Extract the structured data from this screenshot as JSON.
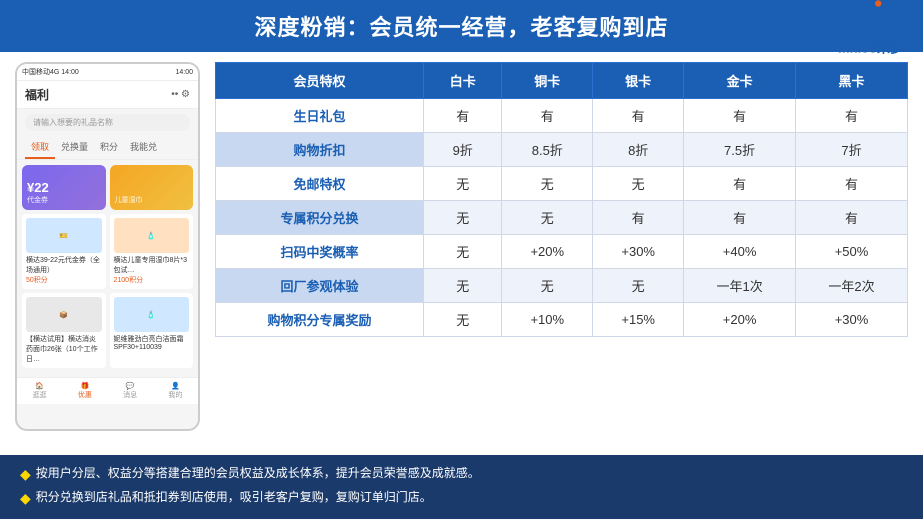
{
  "header": {
    "title": "深度粉销：会员统一经营，老客复购到店"
  },
  "logo": {
    "name": "midoo米多",
    "alt": "midoo logo"
  },
  "phone": {
    "status_bar": "中国移动4G  14:00",
    "nav_title": "福利",
    "search_placeholder": "请输入想要的礼品名称",
    "tabs": [
      "领取",
      "兑换量",
      "积分",
      "我能兑"
    ],
    "active_tab": "领取",
    "card1_amount": "¥22",
    "card1_desc": "代金券",
    "card2_desc": "儿童湿巾",
    "product1_name": "横达39-22元代金券（全场通用）",
    "product1_pts": "50积分",
    "product2_name": "横达儿童专用湿巾8片*3包试…",
    "product2_pts": "2100积分",
    "product3_name": "【横达试用】横达消炎药面巾26张（10个工作日…",
    "product4_name": "妮维雅劲白亮白洁面霜SPF30+110039",
    "bottom_nav": [
      "逛逛",
      "优惠",
      "消息",
      "我的"
    ]
  },
  "table": {
    "headers": [
      "会员特权",
      "白卡",
      "铜卡",
      "银卡",
      "金卡",
      "黑卡"
    ],
    "rows": [
      [
        "生日礼包",
        "有",
        "有",
        "有",
        "有",
        "有"
      ],
      [
        "购物折扣",
        "9折",
        "8.5折",
        "8折",
        "7.5折",
        "7折"
      ],
      [
        "免邮特权",
        "无",
        "无",
        "无",
        "有",
        "有"
      ],
      [
        "专属积分兑换",
        "无",
        "无",
        "有",
        "有",
        "有"
      ],
      [
        "扫码中奖概率",
        "无",
        "+20%",
        "+30%",
        "+40%",
        "+50%"
      ],
      [
        "回厂参观体验",
        "无",
        "无",
        "无",
        "一年1次",
        "一年2次"
      ],
      [
        "购物积分专属奖励",
        "无",
        "+10%",
        "+15%",
        "+20%",
        "+30%"
      ]
    ]
  },
  "footer": {
    "items": [
      "按用户分层、权益分等搭建合理的会员权益及成长体系，提升会员荣誉感及成就感。",
      "积分兑换到店礼品和抵扣券到店使用，吸引老客户复购，复购订单归门店。"
    ]
  }
}
